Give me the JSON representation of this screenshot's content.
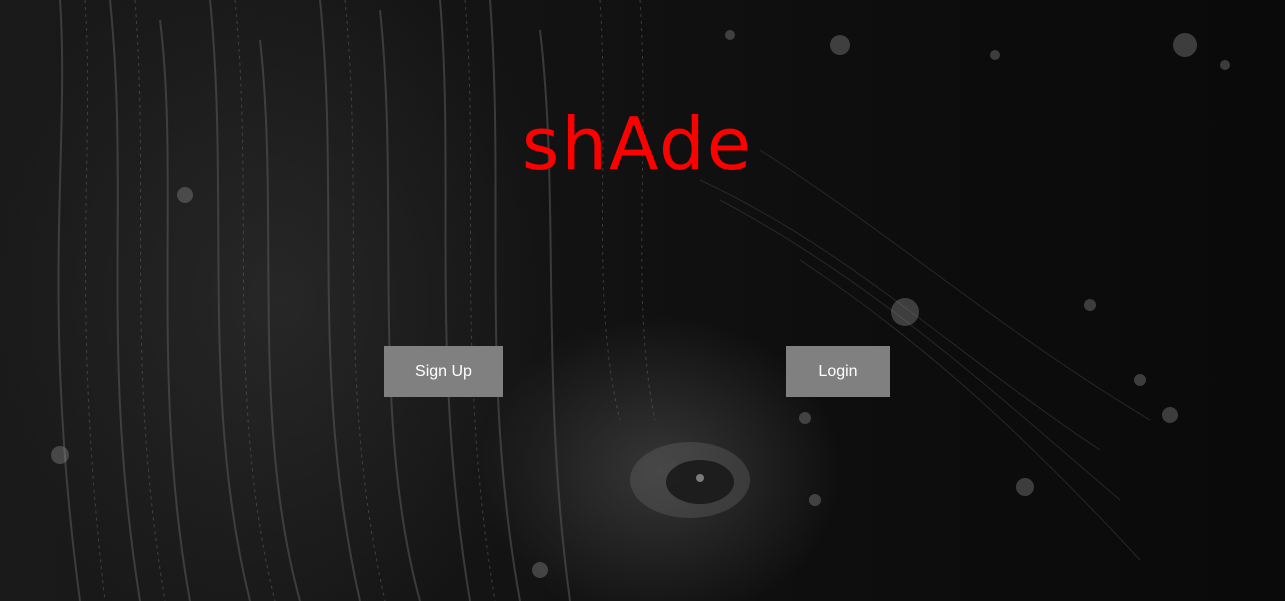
{
  "brand": {
    "title": "shAde",
    "color": "#ff0000"
  },
  "buttons": {
    "signup_label": "Sign Up",
    "login_label": "Login",
    "background": "#808080",
    "text_color": "#ffffff"
  },
  "background": {
    "description_icon": "dark-hair-face-photo"
  }
}
